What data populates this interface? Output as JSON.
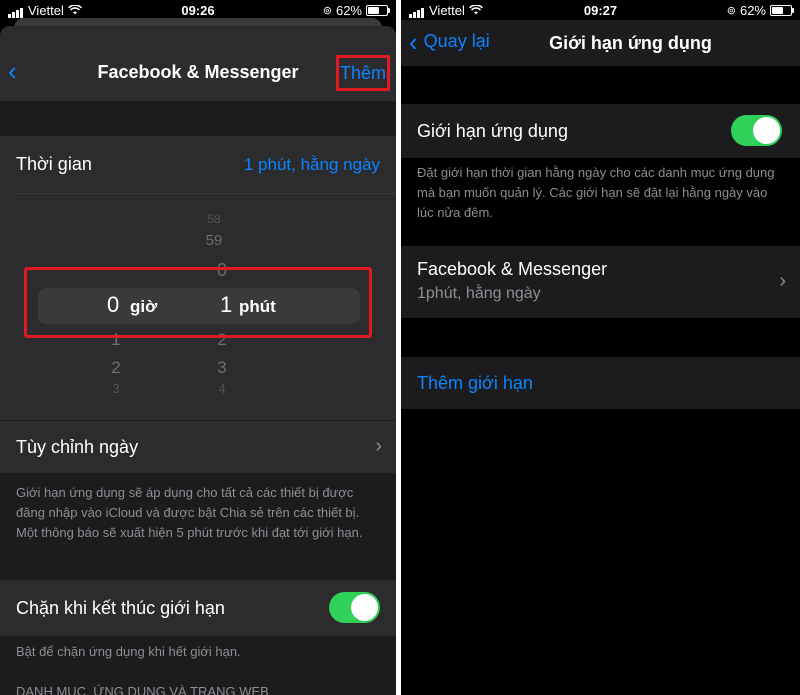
{
  "left": {
    "status": {
      "carrier": "Viettel",
      "time": "09:26",
      "battery": "62%"
    },
    "nav": {
      "title": "Facebook & Messenger",
      "add_label": "Thêm"
    },
    "time_row": {
      "label": "Thời gian",
      "value": "1 phút, hằng ngày"
    },
    "picker": {
      "hours_above": [
        "1",
        "2",
        "3"
      ],
      "hours_selected": "0",
      "hours_unit": "giờ",
      "minutes_above": [
        "58",
        "59",
        "0"
      ],
      "minutes_selected": "1",
      "minutes_unit": "phút",
      "minutes_below": [
        "2",
        "3",
        "4"
      ]
    },
    "customize_row": {
      "label": "Tùy chỉnh ngày"
    },
    "customize_note": "Giới hạn ứng dụng sẽ áp dụng cho tất cả các thiết bị được đăng nhập vào iCloud và được bật Chia sẻ trên các thiết bị. Một thông báo sẽ xuất hiện 5 phút trước khi đạt tới giới hạn.",
    "block_row": {
      "label": "Chặn khi kết thúc giới hạn",
      "toggle_on": true
    },
    "block_note": "Bật để chặn ứng dụng khi hết giới hạn.",
    "section_header": "DANH MỤC, ỨNG DỤNG VÀ TRANG WEB"
  },
  "right": {
    "status": {
      "carrier": "Viettel",
      "time": "09:27",
      "battery": "62%"
    },
    "nav": {
      "back_label": "Quay lại",
      "title": "Giới hạn ứng dụng"
    },
    "limit_row": {
      "label": "Giới hạn ứng dụng",
      "toggle_on": true
    },
    "limit_note": "Đặt giới hạn thời gian hằng ngày cho các danh mục ứng dụng mà bạn muốn quản lý. Các giới hạn sẽ đặt lại hằng ngày vào lúc nửa đêm.",
    "app_row": {
      "title": "Facebook & Messenger",
      "subtitle": "1phút, hằng ngày"
    },
    "add_limit": "Thêm giới hạn"
  },
  "colors": {
    "accent": "#0a84ff",
    "toggle_on": "#30d158",
    "highlight": "#e01a22"
  }
}
